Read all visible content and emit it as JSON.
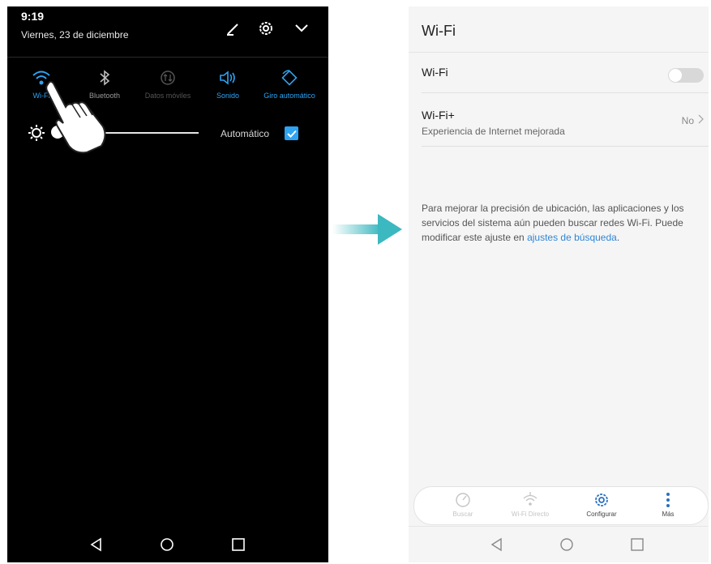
{
  "left": {
    "status": {
      "time": "9:19",
      "date": "Viernes, 23 de diciembre"
    },
    "header_icons": [
      "edit-icon",
      "settings-gear-icon",
      "chevron-down-icon"
    ],
    "toggles": [
      {
        "label": "Wi-Fi",
        "state": "on"
      },
      {
        "label": "Bluetooth",
        "state": "off"
      },
      {
        "label": "Datos móviles",
        "state": "disabled"
      },
      {
        "label": "Sonido",
        "state": "on"
      },
      {
        "label": "Giro automático",
        "state": "on"
      }
    ],
    "brightness": {
      "auto_label": "Automático",
      "auto_checked": true
    },
    "nav": [
      "back",
      "home",
      "recents"
    ]
  },
  "right": {
    "title": "Wi-Fi",
    "wifi_row": {
      "label": "Wi-Fi",
      "enabled": false
    },
    "wifi_plus_row": {
      "label": "Wi-Fi+",
      "subtitle": "Experiencia de Internet mejorada",
      "value": "No"
    },
    "info": {
      "text": "Para mejorar la precisión de ubicación, las aplicaciones y los servicios del sistema aún pueden buscar redes Wi-Fi. Puede modificar este ajuste en ",
      "link": "ajustes de búsqueda",
      "end": "."
    },
    "bottom_tabs": [
      {
        "label": "Buscar",
        "enabled": false
      },
      {
        "label": "Wi-Fi Directo",
        "enabled": false
      },
      {
        "label": "Configurar",
        "enabled": true
      },
      {
        "label": "Más",
        "enabled": true
      }
    ]
  },
  "colors": {
    "accent": "#2ea3f2",
    "arrow": "#3cb8c0",
    "link": "#2f86d6"
  }
}
